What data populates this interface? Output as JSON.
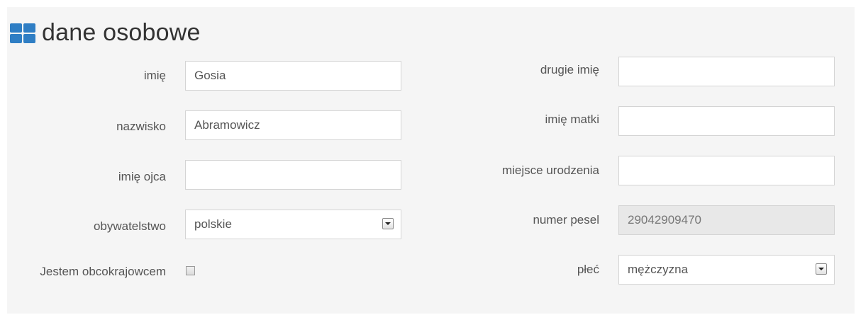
{
  "section": {
    "title": "dane osobowe",
    "icon": "grid-icon",
    "accent_color": "#2f7ec4"
  },
  "left_fields": [
    {
      "label": "imię",
      "value": "Gosia"
    },
    {
      "label": "nazwisko",
      "value": "Abramowicz"
    },
    {
      "label": "imię ojca",
      "value": ""
    },
    {
      "label": "obywatelstwo",
      "value": "polskie"
    }
  ],
  "foreigner_checkbox": {
    "label": "Jestem obcokrajowcem",
    "checked": false
  },
  "right_fields": [
    {
      "label": "drugie imię",
      "value": ""
    },
    {
      "label": "imię matki",
      "value": ""
    },
    {
      "label": "miejsce urodzenia",
      "value": ""
    },
    {
      "label": "numer pesel",
      "value": "29042909470"
    },
    {
      "label": "płeć",
      "value": "mężczyzna"
    }
  ]
}
